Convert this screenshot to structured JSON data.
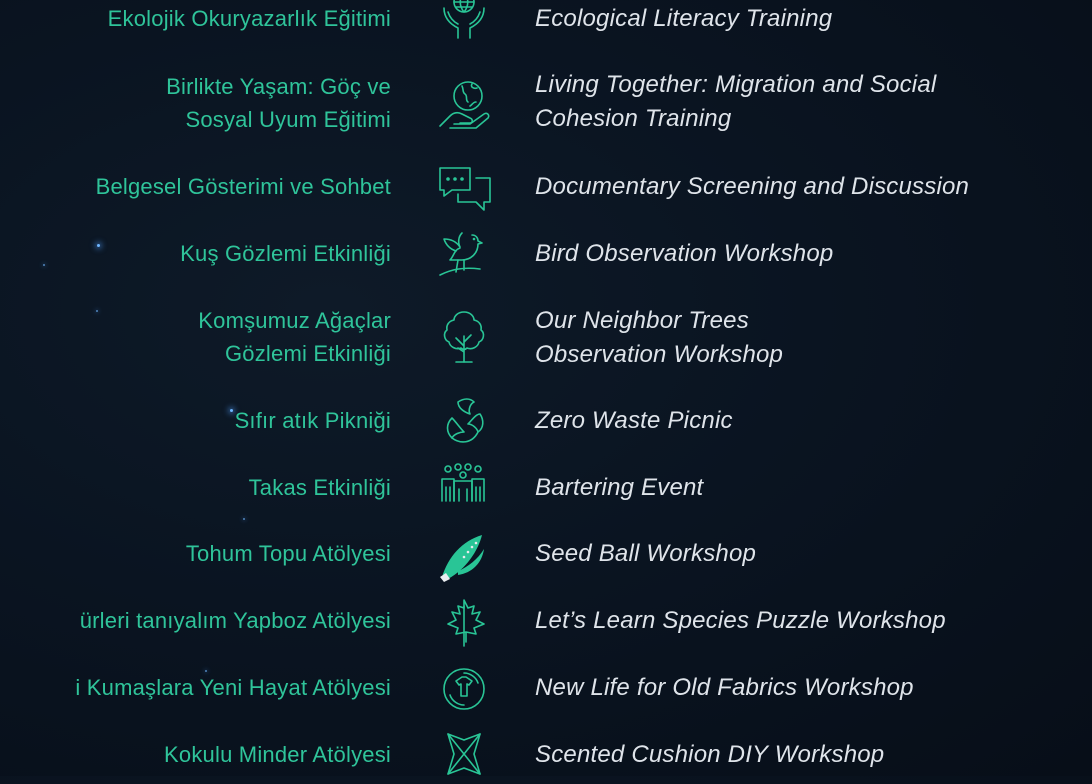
{
  "colors": {
    "background": "#0a1421",
    "turkish_text": "#2fc49a",
    "english_text": "#dfe4ea",
    "icon": "#29c596"
  },
  "activities": [
    {
      "tr_lines": [
        "Ekolojik Okuryazarlık Eğitimi"
      ],
      "en_lines": [
        "Ecological Literacy Training"
      ],
      "icon": "globe-in-hands-icon"
    },
    {
      "tr_lines": [
        "Birlikte Yaşam: Göç ve",
        "Sosyal Uyum Eğitimi"
      ],
      "en_lines": [
        "Living Together: Migration and Social",
        "Cohesion Training"
      ],
      "icon": "hand-holding-globe-icon"
    },
    {
      "tr_lines": [
        "Belgesel Gösterimi ve Sohbet"
      ],
      "en_lines": [
        "Documentary Screening and Discussion"
      ],
      "icon": "chat-bubbles-icon"
    },
    {
      "tr_lines": [
        "Kuş Gözlemi Etkinliği"
      ],
      "en_lines": [
        "Bird Observation Workshop"
      ],
      "icon": "bird-on-branch-icon"
    },
    {
      "tr_lines": [
        "Komşumuz Ağaçlar",
        "Gözlemi Etkinliği"
      ],
      "en_lines": [
        "Our Neighbor Trees",
        "Observation Workshop"
      ],
      "icon": "tree-icon"
    },
    {
      "tr_lines": [
        "Sıfır atık Pikniği"
      ],
      "en_lines": [
        "Zero Waste Picnic"
      ],
      "icon": "recycle-leaves-icon"
    },
    {
      "tr_lines": [
        "Takas Etkinliği"
      ],
      "en_lines": [
        "Bartering Event"
      ],
      "icon": "people-group-icon"
    },
    {
      "tr_lines": [
        "Tohum Topu Atölyesi"
      ],
      "en_lines": [
        "Seed Ball Workshop"
      ],
      "icon": "corn-seed-icon"
    },
    {
      "tr_lines": [
        "ürleri tanıyalım Yapboz Atölyesi"
      ],
      "en_lines": [
        "Let’s Learn Species Puzzle Workshop"
      ],
      "icon": "maple-leaf-icon"
    },
    {
      "tr_lines": [
        "i Kumaşlara Yeni Hayat Atölyesi"
      ],
      "en_lines": [
        "New Life for Old Fabrics Workshop"
      ],
      "icon": "recycle-shirt-icon"
    },
    {
      "tr_lines": [
        "Kokulu Minder Atölyesi"
      ],
      "en_lines": [
        "Scented Cushion DIY Workshop"
      ],
      "icon": "cushion-icon"
    }
  ]
}
